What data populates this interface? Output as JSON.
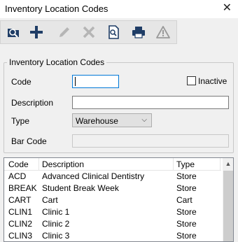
{
  "window": {
    "title": "Inventory Location Codes",
    "close_glyph": "✕"
  },
  "toolbar": {
    "icons": [
      "search-folder-icon",
      "plus-icon",
      "edit-pencil-icon",
      "delete-x-icon",
      "preview-document-icon",
      "printer-icon",
      "warning-triangle-icon"
    ],
    "accent": "#1f3d66"
  },
  "form": {
    "group_title": "Inventory Location Codes",
    "code_label": "Code",
    "code_value": "",
    "inactive_label": "Inactive",
    "inactive_checked": false,
    "description_label": "Description",
    "description_value": "",
    "type_label": "Type",
    "type_value": "Warehouse",
    "barcode_label": "Bar Code",
    "barcode_value": ""
  },
  "table": {
    "columns": [
      "Code",
      "Description",
      "Type"
    ],
    "rows": [
      [
        "ACD",
        "Advanced Clinical Dentistry",
        "Store"
      ],
      [
        "BREAK",
        "Student Break Week",
        "Store"
      ],
      [
        "CART",
        "Cart",
        "Cart"
      ],
      [
        "CLIN1",
        "Clinic 1",
        "Store"
      ],
      [
        "CLIN2",
        "Clinic 2",
        "Store"
      ],
      [
        "CLIN3",
        "Clinic 3",
        "Store"
      ]
    ]
  }
}
